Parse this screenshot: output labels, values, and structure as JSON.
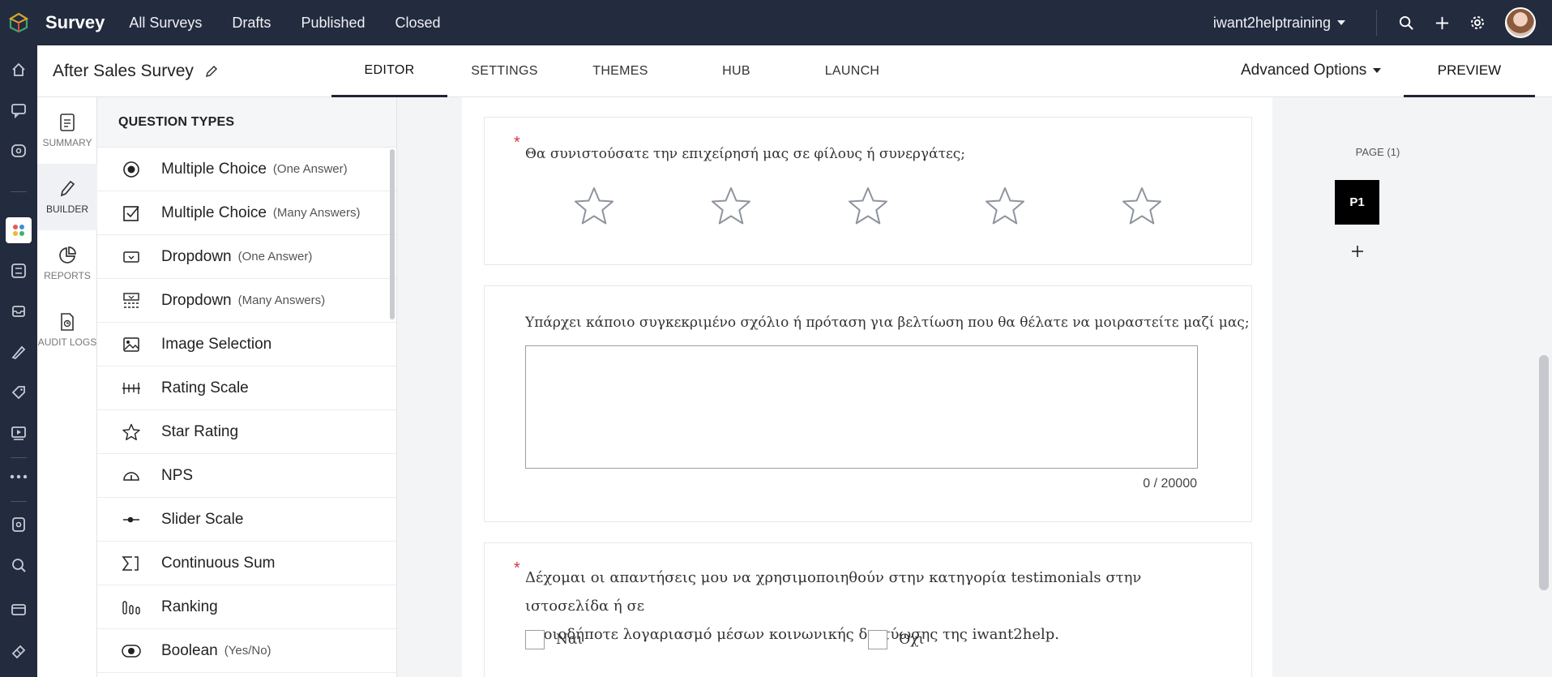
{
  "topbar": {
    "brand": "Survey",
    "nav": [
      "All Surveys",
      "Drafts",
      "Published",
      "Closed"
    ],
    "workspace": "iwant2helptraining",
    "icons": [
      "search-icon",
      "plus-icon",
      "gear-icon"
    ]
  },
  "subheader": {
    "survey_name": "After Sales Survey",
    "tabs": [
      "EDITOR",
      "SETTINGS",
      "THEMES",
      "HUB",
      "LAUNCH"
    ],
    "active_tab": "EDITOR",
    "advanced_options": "Advanced Options",
    "preview": "PREVIEW"
  },
  "modes": [
    {
      "label": "SUMMARY",
      "icon": "document-icon"
    },
    {
      "label": "BUILDER",
      "icon": "pencil-icon"
    },
    {
      "label": "REPORTS",
      "icon": "pie-chart-icon"
    },
    {
      "label": "AUDIT LOGS",
      "icon": "audit-log-icon"
    }
  ],
  "question_types": {
    "header": "QUESTION TYPES",
    "items": [
      {
        "label": "Multiple Choice",
        "sub": "(One Answer)",
        "icon": "radio-icon"
      },
      {
        "label": "Multiple Choice",
        "sub": "(Many Answers)",
        "icon": "checkbox-icon"
      },
      {
        "label": "Dropdown",
        "sub": "(One Answer)",
        "icon": "dropdown-icon"
      },
      {
        "label": "Dropdown",
        "sub": "(Many Answers)",
        "icon": "multi-dropdown-icon"
      },
      {
        "label": "Image Selection",
        "sub": "",
        "icon": "image-icon"
      },
      {
        "label": "Rating Scale",
        "sub": "",
        "icon": "rating-scale-icon"
      },
      {
        "label": "Star Rating",
        "sub": "",
        "icon": "star-icon"
      },
      {
        "label": "NPS",
        "sub": "",
        "icon": "gauge-icon"
      },
      {
        "label": "Slider Scale",
        "sub": "",
        "icon": "slider-icon"
      },
      {
        "label": "Continuous Sum",
        "sub": "",
        "icon": "sigma-icon"
      },
      {
        "label": "Ranking",
        "sub": "",
        "icon": "ranking-icon"
      },
      {
        "label": "Boolean",
        "sub": "(Yes/No)",
        "icon": "boolean-icon"
      }
    ]
  },
  "questions": {
    "q1": {
      "text": "Θα συνιστούσατε την επιχείρησή μας σε φίλους ή συνεργάτες;",
      "required_mark": "*",
      "stars": 5
    },
    "q2": {
      "text": "Υπάρχει κάποιο συγκεκριμένο σχόλιο ή πρόταση για βελτίωση που θα θέλατε να μοιραστείτε μαζί μας;",
      "counter": "0 / 20000"
    },
    "q3": {
      "required_mark": "*",
      "line1": "Δέχομαι οι απαντήσεις μου να χρησιμοποιηθούν στην κατηγορία testimonials στην ιστοσελίδα ή σε",
      "line2": "οποιοδήποτε λογαριασμό μέσων κοινωνικής δικτύωσης της iwant2help.",
      "options": [
        "Ναι",
        "Όχι"
      ]
    }
  },
  "pages_panel": {
    "label": "PAGE (1)",
    "current": "P1"
  }
}
